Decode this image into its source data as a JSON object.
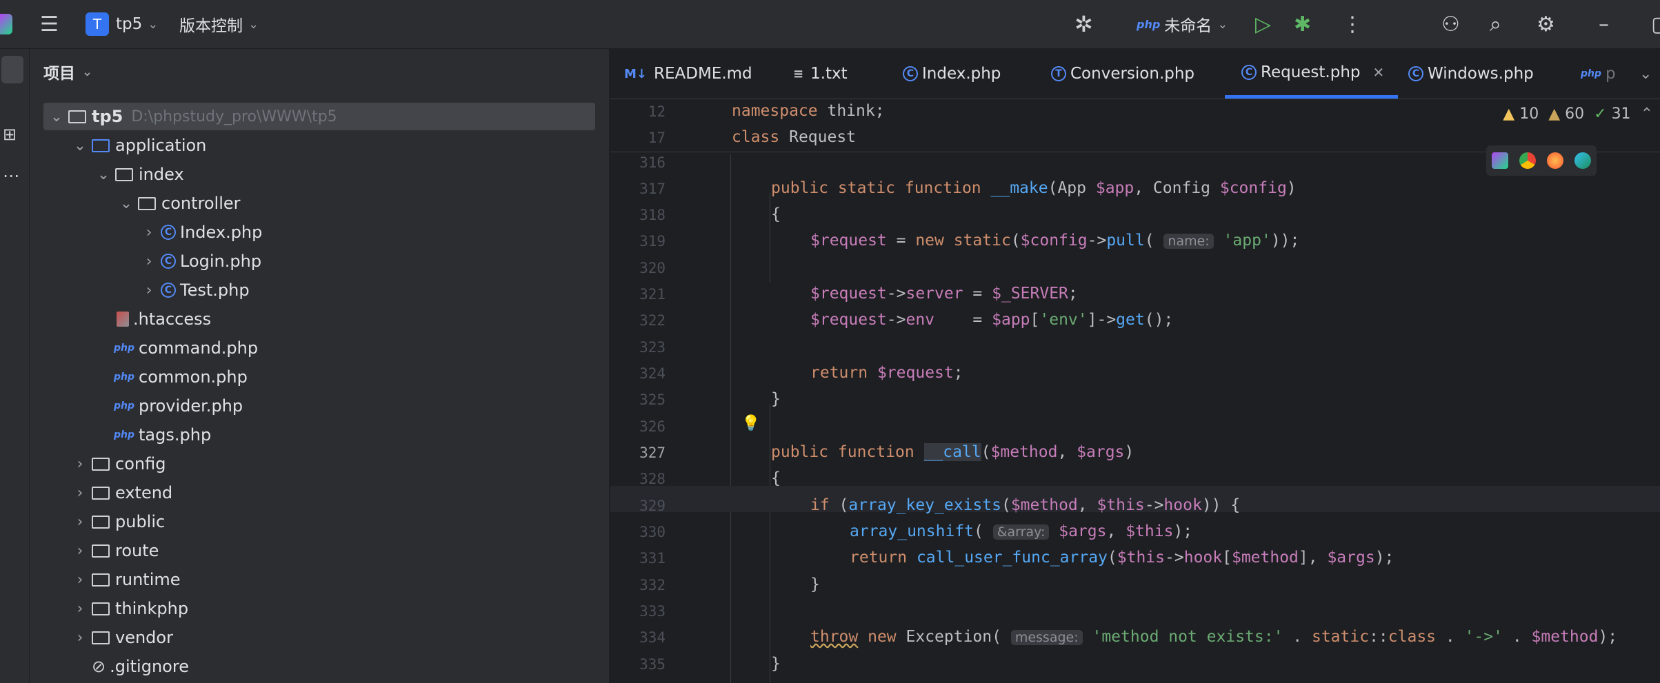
{
  "topbar": {
    "project_initial": "T",
    "project_name": "tp5",
    "vcs_label": "版本控制",
    "run_config": "未命名"
  },
  "project_panel": {
    "title": "项目",
    "tree": [
      {
        "label": "tp5",
        "path": "D:\\phpstudy_pro\\WWW\\tp5"
      },
      {
        "label": "application"
      },
      {
        "label": "index"
      },
      {
        "label": "controller"
      },
      {
        "label": "Index.php"
      },
      {
        "label": "Login.php"
      },
      {
        "label": "Test.php"
      },
      {
        "label": ".htaccess"
      },
      {
        "label": "command.php"
      },
      {
        "label": "common.php"
      },
      {
        "label": "provider.php"
      },
      {
        "label": "tags.php"
      },
      {
        "label": "config"
      },
      {
        "label": "extend"
      },
      {
        "label": "public"
      },
      {
        "label": "route"
      },
      {
        "label": "runtime"
      },
      {
        "label": "thinkphp"
      },
      {
        "label": "vendor"
      },
      {
        "label": ".gitignore"
      }
    ]
  },
  "tabs": [
    {
      "label": "README.md",
      "icon": "M↓"
    },
    {
      "label": "1.txt",
      "icon": "≡"
    },
    {
      "label": "Index.php",
      "icon": "C"
    },
    {
      "label": "Conversion.php",
      "icon": "T"
    },
    {
      "label": "Request.php",
      "icon": "C"
    },
    {
      "label": "Windows.php",
      "icon": "C"
    },
    {
      "label": "p",
      "icon": "php"
    }
  ],
  "inspections": {
    "errors": "10",
    "warnings": "60",
    "typos": "31"
  },
  "sticky_lines": [
    {
      "num": "12",
      "text": "namespace think;"
    },
    {
      "num": "17",
      "text": "class Request"
    }
  ],
  "line_numbers": [
    "316",
    "317",
    "318",
    "319",
    "320",
    "321",
    "322",
    "323",
    "324",
    "325",
    "326",
    "327",
    "328",
    "329",
    "330",
    "331",
    "332",
    "333",
    "334",
    "335"
  ],
  "hints": {
    "name": "name:",
    "array": "&array:",
    "message": "message:"
  },
  "colors": {
    "accent": "#3574f0",
    "keyword": "#cf8e6d",
    "function": "#56a8f5",
    "variable": "#c77dba",
    "string": "#6aab73"
  }
}
